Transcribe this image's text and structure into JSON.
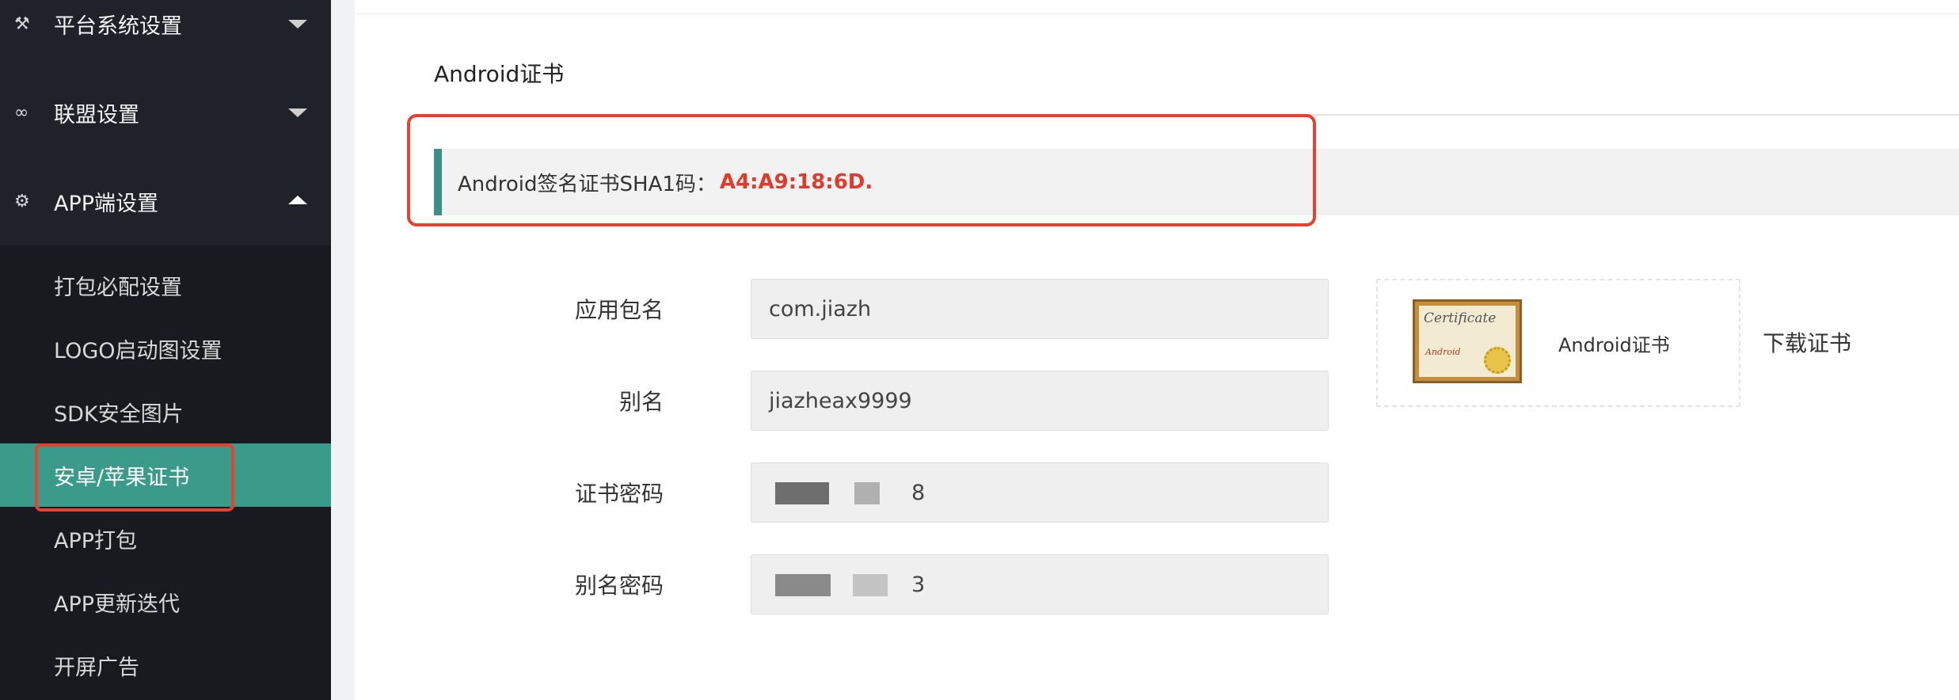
{
  "sidebar": {
    "top_menus": [
      {
        "icon": "tools-icon",
        "glyph": "⚒",
        "label": "平台系统设置"
      },
      {
        "icon": "link-icon",
        "glyph": "∞",
        "label": "联盟设置"
      },
      {
        "icon": "gear-icon",
        "glyph": "⚙",
        "label": "APP端设置"
      }
    ],
    "sub_items": [
      {
        "label": "打包必配设置"
      },
      {
        "label": "LOGO启动图设置"
      },
      {
        "label": "SDK安全图片"
      },
      {
        "label": "安卓/苹果证书",
        "active": true
      },
      {
        "label": "APP打包"
      },
      {
        "label": "APP更新迭代"
      },
      {
        "label": "开屏广告"
      }
    ]
  },
  "main": {
    "tab_title": "Android证书",
    "sha_label": "Android签名证书SHA1码：",
    "sha_value": "A4:A9:18:6D.",
    "fields": [
      {
        "label": "应用包名",
        "value": "com.jiazh"
      },
      {
        "label": "别名",
        "value": "jiazheax9999"
      },
      {
        "label": "证书密码",
        "value": "8"
      },
      {
        "label": "别名密码",
        "value": "3"
      }
    ],
    "certificate": {
      "image_text": "Certificate",
      "image_subtext": "Android",
      "name": "Android证书",
      "download_label": "下载证书"
    }
  },
  "colors": {
    "sidebar_bg": "#20222a",
    "active_item": "#3a9b8a",
    "highlight_border": "#e64232",
    "sha_value": "#e03a2d",
    "sha_bar_accent": "#3d8f86"
  }
}
